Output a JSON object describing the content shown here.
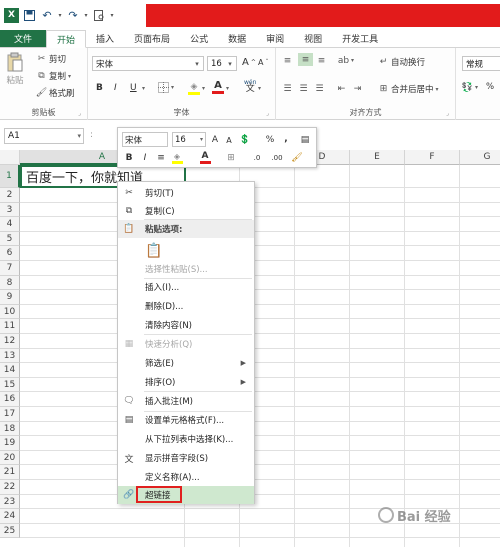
{
  "qat": {
    "app_icon": "X",
    "save_icon": "save-icon",
    "undo_icon": "undo-icon",
    "redo_icon": "redo-icon",
    "preview_icon": "print-preview-icon"
  },
  "tabs": [
    "文件",
    "开始",
    "插入",
    "页面布局",
    "公式",
    "数据",
    "审阅",
    "视图",
    "开发工具"
  ],
  "ribbon": {
    "clipboard": {
      "paste": "粘贴",
      "cut": "剪切",
      "copy": "复制",
      "format_painter": "格式刷",
      "label": "剪贴板"
    },
    "font": {
      "name": "宋体",
      "size": "16",
      "grow": "A",
      "shrink": "A",
      "bold": "B",
      "italic": "I",
      "underline": "U",
      "phonetic": "wén",
      "label": "字体"
    },
    "alignment": {
      "wrap": "自动换行",
      "merge": "合并后居中",
      "label": "对齐方式"
    },
    "number": {
      "format": "常规",
      "percent": "%"
    }
  },
  "formula_bar": {
    "name_box": "A1",
    "separator": ":"
  },
  "grid": {
    "columns": [
      "A",
      "B",
      "C",
      "D",
      "E",
      "F",
      "G"
    ],
    "rows": [
      "1",
      "2",
      "3",
      "4",
      "5",
      "6",
      "7",
      "8",
      "9",
      "10",
      "11",
      "12",
      "13",
      "14",
      "15",
      "16",
      "17",
      "18",
      "19",
      "20",
      "21",
      "22",
      "23",
      "24",
      "25"
    ],
    "a1_value": "百度一下，你就知道"
  },
  "mini_toolbar": {
    "font": "宋体",
    "size": "16",
    "grow": "A",
    "shrink": "A",
    "percent": "%",
    "comma": ",",
    "bold": "B",
    "italic": "I",
    "dec_inc": ".0",
    "dec_dec": ".00"
  },
  "context_menu": {
    "items": [
      {
        "label": "剪切(T)",
        "icon": "scissors-icon",
        "disabled": false
      },
      {
        "label": "复制(C)",
        "icon": "copy-icon",
        "disabled": false
      },
      {
        "label": "粘贴选项:",
        "icon": "paste-icon",
        "header": true
      },
      {
        "label": "选择性粘贴(S)...",
        "icon": "",
        "disabled": true
      },
      {
        "label": "插入(I)...",
        "icon": "",
        "disabled": false
      },
      {
        "label": "删除(D)...",
        "icon": "",
        "disabled": false
      },
      {
        "label": "清除内容(N)",
        "icon": "",
        "disabled": false
      },
      {
        "label": "快速分析(Q)",
        "icon": "quick-analysis-icon",
        "disabled": true
      },
      {
        "label": "筛选(E)",
        "icon": "",
        "disabled": false,
        "submenu": true
      },
      {
        "label": "排序(O)",
        "icon": "",
        "disabled": false,
        "submenu": true
      },
      {
        "label": "插入批注(M)",
        "icon": "comment-icon",
        "disabled": false
      },
      {
        "label": "设置单元格格式(F)...",
        "icon": "format-cells-icon",
        "disabled": false
      },
      {
        "label": "从下拉列表中选择(K)...",
        "icon": "",
        "disabled": false
      },
      {
        "label": "显示拼音字段(S)",
        "icon": "phonetic-icon",
        "disabled": false
      },
      {
        "label": "定义名称(A)...",
        "icon": "",
        "disabled": false
      },
      {
        "label": "超链接",
        "icon": "hyperlink-icon",
        "disabled": false,
        "highlighted": true
      }
    ]
  },
  "watermark": "Bai 经验"
}
